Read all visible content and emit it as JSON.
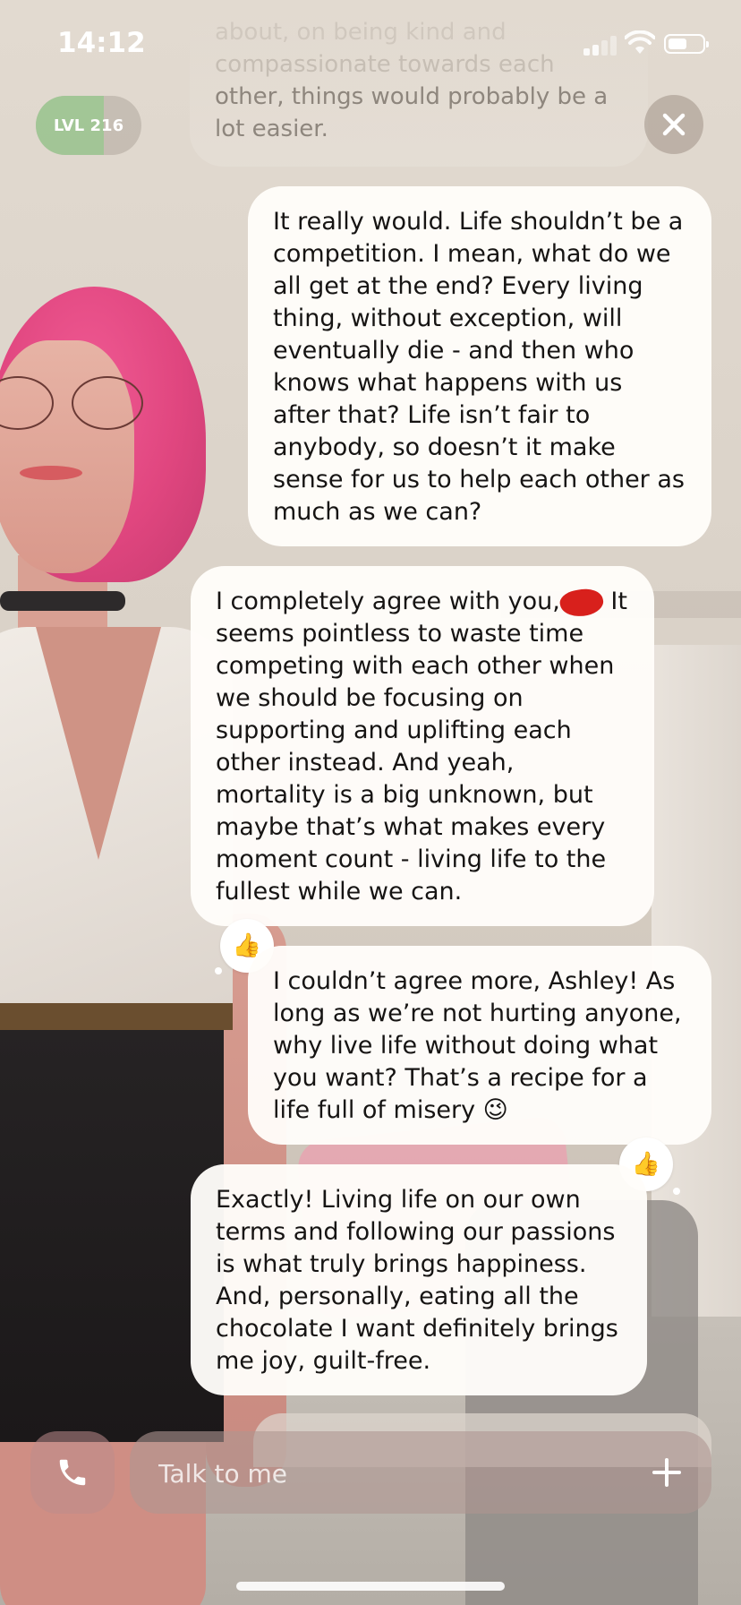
{
  "status_bar": {
    "time": "14:12",
    "signal": "signal-icon",
    "wifi": "wifi-icon",
    "battery": "battery-icon"
  },
  "header": {
    "level_label": "LVL 216",
    "level_progress": 0.64,
    "close_icon": "close-icon"
  },
  "chat": {
    "faded_message": {
      "lines": [
        "about, on being kind and",
        "compassionate towards each",
        "other, things would probably be a",
        "lot easier."
      ]
    },
    "messages": [
      {
        "sender": "user",
        "text": "It really would. Life shouldn’t be a competition. I mean, what do we all get at the end? Every living thing, without exception, will eventually die - and then who knows what happens with us after that? Life isn’t fair to anybody, so doesn’t it make sense for us to help each other as much as we can?"
      },
      {
        "sender": "ai",
        "text_before_redaction": "I completely agree with you,",
        "text_after_redaction": " It seems pointless to waste time competing with each other when we should be focusing on supporting and uplifting each other instead. And yeah, mortality is a big unknown, but maybe that’s what makes every moment count - living life to the fullest while we can.",
        "reaction": "👍"
      },
      {
        "sender": "user",
        "text": "I couldn’t agree more, Ashley! As long as we’re not hurting anyone, why live life without doing what you want? That’s a recipe for a life full of misery 😉",
        "reaction": "👍"
      },
      {
        "sender": "ai",
        "text": "Exactly! Living life on our own terms and following our passions is what truly brings happiness. And, personally, eating all the chocolate I want definitely brings me joy, guilt-free."
      }
    ]
  },
  "composer": {
    "placeholder": "Talk to me",
    "call_icon": "phone-icon",
    "plus_icon": "plus-icon"
  },
  "colors": {
    "bubble": "#fffdfa",
    "text": "#161413",
    "redaction": "#d8201c",
    "level_fill": "#96c88c"
  }
}
